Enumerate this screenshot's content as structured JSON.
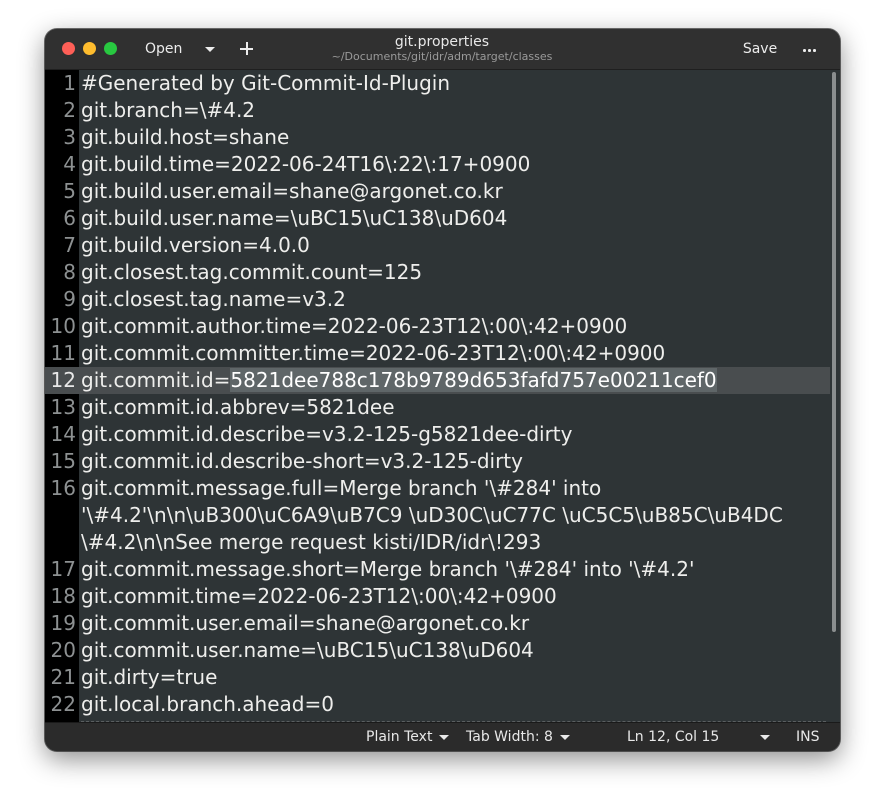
{
  "window": {
    "title": "git.properties",
    "subtitle": "~/Documents/git/idr/adm/target/classes",
    "open_label": "Open",
    "save_label": "Save",
    "new_tab_icon": "plus-icon",
    "menu_icon": "ellipsis-icon"
  },
  "editor": {
    "current_line": 12,
    "selection": "5821dee788c178b9789d653fafd757e00211cef0",
    "lines": [
      {
        "n": "1",
        "text": "#Generated by Git-Commit-Id-Plugin"
      },
      {
        "n": "2",
        "text": "git.branch=\\#4.2"
      },
      {
        "n": "3",
        "text": "git.build.host=shane"
      },
      {
        "n": "4",
        "text": "git.build.time=2022-06-24T16\\:22\\:17+0900"
      },
      {
        "n": "5",
        "text": "git.build.user.email=shane@argonet.co.kr"
      },
      {
        "n": "6",
        "text": "git.build.user.name=\\uBC15\\uC138\\uD604"
      },
      {
        "n": "7",
        "text": "git.build.version=4.0.0"
      },
      {
        "n": "8",
        "text": "git.closest.tag.commit.count=125"
      },
      {
        "n": "9",
        "text": "git.closest.tag.name=v3.2"
      },
      {
        "n": "10",
        "text": "git.commit.author.time=2022-06-23T12\\:00\\:42+0900"
      },
      {
        "n": "11",
        "text": "git.commit.committer.time=2022-06-23T12\\:00\\:42+0900"
      },
      {
        "n": "12",
        "text": "git.commit.id=",
        "selected": "5821dee788c178b9789d653fafd757e00211cef0",
        "current": true
      },
      {
        "n": "13",
        "text": "git.commit.id.abbrev=5821dee"
      },
      {
        "n": "14",
        "text": "git.commit.id.describe=v3.2-125-g5821dee-dirty"
      },
      {
        "n": "15",
        "text": "git.commit.id.describe-short=v3.2-125-dirty"
      },
      {
        "n": "16",
        "text": "git.commit.message.full=Merge branch '\\#284' into"
      },
      {
        "n": "",
        "text": "'\\#4.2'\\n\\n\\uB300\\uC6A9\\uB7C9 \\uD30C\\uC77C \\uC5C5\\uB85C\\uB4DC"
      },
      {
        "n": "",
        "text": "\\#4.2\\n\\nSee merge request kisti/IDR/idr\\!293"
      },
      {
        "n": "17",
        "text": "git.commit.message.short=Merge branch '\\#284' into '\\#4.2'"
      },
      {
        "n": "18",
        "text": "git.commit.time=2022-06-23T12\\:00\\:42+0900"
      },
      {
        "n": "19",
        "text": "git.commit.user.email=shane@argonet.co.kr"
      },
      {
        "n": "20",
        "text": "git.commit.user.name=\\uBC15\\uC138\\uD604"
      },
      {
        "n": "21",
        "text": "git.dirty=true"
      },
      {
        "n": "22",
        "text": "git.local.branch.ahead=0"
      }
    ]
  },
  "statusbar": {
    "language": "Plain Text",
    "tab_width": "Tab Width: 8",
    "cursor": "Ln 12, Col 15",
    "mode": "INS"
  },
  "colors": {
    "editor_bg": "#2e3436",
    "gutter_bg": "#000000",
    "current_line_bg": "#494d4f",
    "text": "#eeeeec"
  }
}
